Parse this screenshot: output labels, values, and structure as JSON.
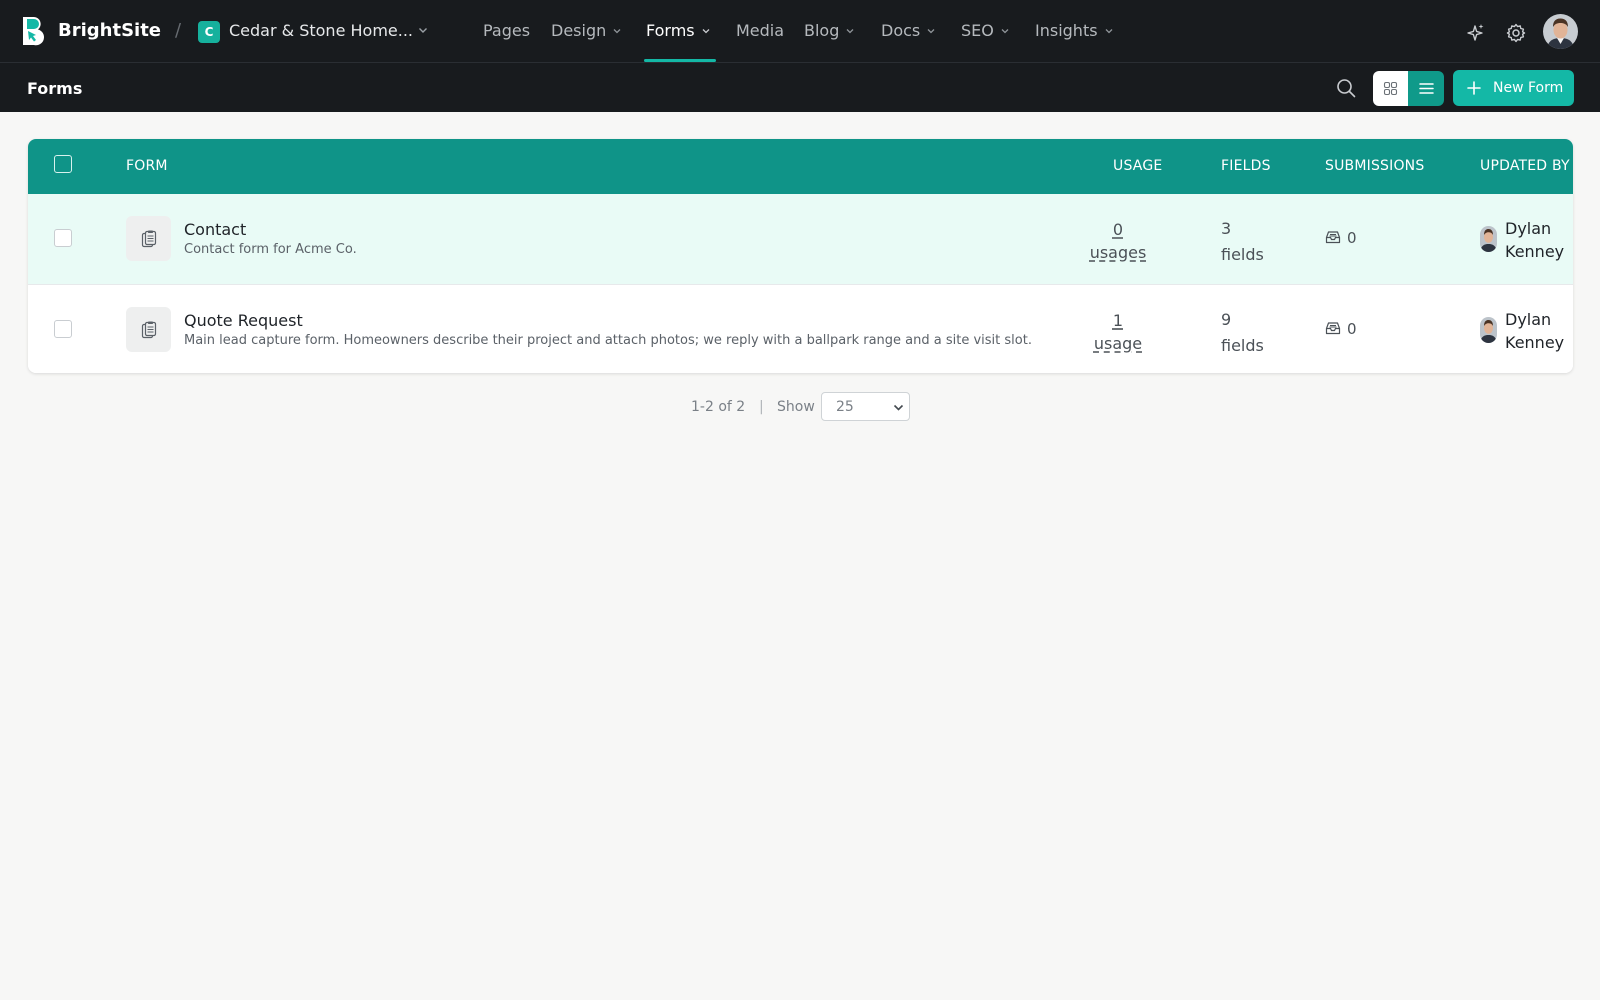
{
  "app": {
    "brand": "BrightSite",
    "separator": "/",
    "site_badge": "C",
    "site_name": "Cedar & Stone Home...",
    "accent_color": "#14b8a6"
  },
  "nav": [
    {
      "label": "Pages",
      "dropdown": false,
      "active": false
    },
    {
      "label": "Design",
      "dropdown": true,
      "active": false
    },
    {
      "label": "Forms",
      "dropdown": true,
      "active": true
    },
    {
      "label": "Media",
      "dropdown": false,
      "active": false
    },
    {
      "label": "Blog",
      "dropdown": true,
      "active": false
    },
    {
      "label": "Docs",
      "dropdown": true,
      "active": false
    },
    {
      "label": "SEO",
      "dropdown": true,
      "active": false
    },
    {
      "label": "Insights",
      "dropdown": true,
      "active": false
    }
  ],
  "topbar_icons": [
    "sparkles-icon",
    "gear-icon",
    "user-avatar"
  ],
  "subbar": {
    "title": "Forms",
    "new_button": "New Form",
    "view_mode": "list"
  },
  "table": {
    "columns": {
      "form": "FORM",
      "usage": "USAGE",
      "fields": "FIELDS",
      "submissions": "SUBMISSIONS",
      "updated_by": "UPDATED BY"
    },
    "rows": [
      {
        "name": "Contact",
        "description": "Contact form for Acme Co.",
        "usage_count": "0",
        "usage_unit": "usages",
        "fields_count": "3",
        "fields_unit": "fields",
        "submissions": "0",
        "updated_by_first": "Dylan",
        "updated_by_last": "Kenney",
        "highlighted": true
      },
      {
        "name": "Quote Request",
        "description": "Main lead capture form. Homeowners describe their project and attach photos; we reply with a ballpark range and a site visit slot.",
        "usage_count": "1",
        "usage_unit": "usage",
        "fields_count": "9",
        "fields_unit": "fields",
        "submissions": "0",
        "updated_by_first": "Dylan",
        "updated_by_last": "Kenney",
        "highlighted": false
      }
    ]
  },
  "pagination": {
    "range": "1-2 of 2",
    "separator": "|",
    "show_label": "Show",
    "page_size": "25"
  }
}
